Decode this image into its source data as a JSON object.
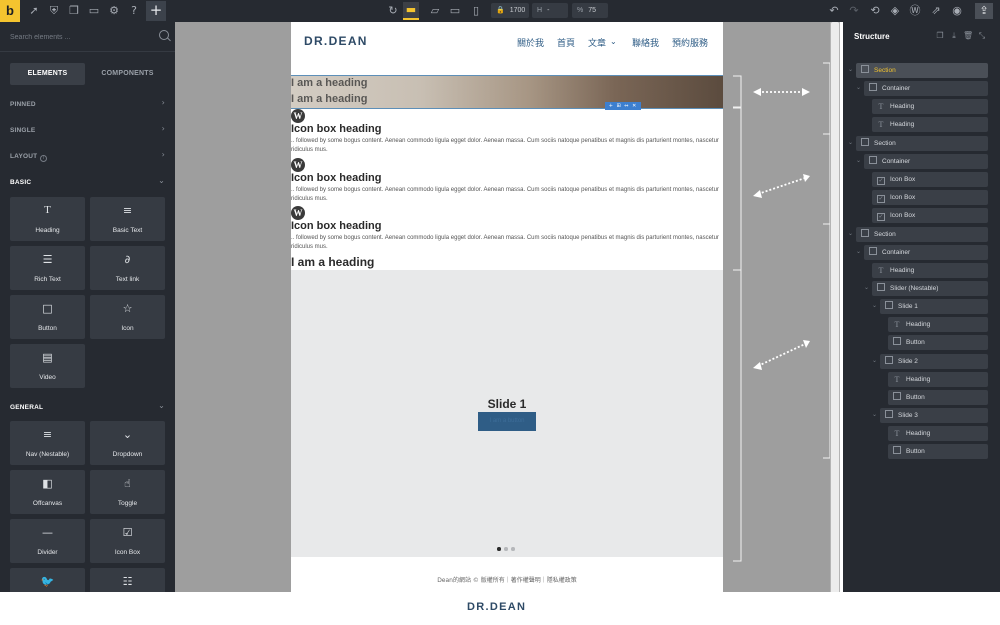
{
  "topbar": {
    "logo": "b",
    "breakpoint_width": "1700",
    "height_label": "H",
    "height_value": "-",
    "zoom_label": "%",
    "zoom_value": "75"
  },
  "left_panel": {
    "search_placeholder": "Search elements ...",
    "tabs": [
      "ELEMENTS",
      "COMPONENTS"
    ],
    "sections": {
      "pinned": "PINNED",
      "single": "SINGLE",
      "layout": "LAYOUT",
      "basic": "BASIC",
      "general": "GENERAL"
    },
    "basic_elements": [
      {
        "label": "Heading",
        "icon": "heading-icon"
      },
      {
        "label": "Basic Text",
        "icon": "basic-text-icon"
      },
      {
        "label": "Rich Text",
        "icon": "rich-text-icon"
      },
      {
        "label": "Text link",
        "icon": "link-icon"
      },
      {
        "label": "Button",
        "icon": "button-icon"
      },
      {
        "label": "Icon",
        "icon": "star-icon"
      },
      {
        "label": "Video",
        "icon": "video-icon"
      }
    ],
    "general_elements": [
      {
        "label": "Nav (Nestable)",
        "icon": "menu-icon"
      },
      {
        "label": "Dropdown",
        "icon": "dropdown-icon"
      },
      {
        "label": "Offcanvas",
        "icon": "offcanvas-icon"
      },
      {
        "label": "Toggle",
        "icon": "toggle-icon"
      },
      {
        "label": "Divider",
        "icon": "divider-icon"
      },
      {
        "label": "Icon Box",
        "icon": "icon-box-icon"
      },
      {
        "label": "",
        "icon": "twitter-icon"
      },
      {
        "label": "",
        "icon": "list-icon"
      }
    ]
  },
  "page": {
    "logo": "DR.DEAN",
    "nav": [
      "關於我",
      "首頁",
      "文章",
      "聯絡我",
      "預約服務"
    ],
    "hero_headings": [
      "I am a heading",
      "I am a heading"
    ],
    "icon_boxes": [
      {
        "heading": "Icon box heading",
        "text": ".. followed by some bogus content. Aenean commodo ligula egget dolor. Aenean massa. Cum sociis natoque penatibus et magnis dis parturient montes, nascetur ridiculus mus."
      },
      {
        "heading": "Icon box heading",
        "text": ".. followed by some bogus content. Aenean commodo ligula egget dolor. Aenean massa. Cum sociis natoque penatibus et magnis dis parturient montes, nascetur ridiculus mus."
      },
      {
        "heading": "Icon box heading",
        "text": ".. followed by some bogus content. Aenean commodo ligula egget dolor. Aenean massa. Cum sociis natoque penatibus et magnis dis parturient montes, nascetur ridiculus mus."
      }
    ],
    "plain_heading": "I am a heading",
    "slide": {
      "title": "Slide 1",
      "button": "I am a button"
    },
    "footer": "Dean的網站 © 版權所有｜著作權聲明｜隱私權政策"
  },
  "structure": {
    "title": "Structure",
    "tree": [
      {
        "label": "Section",
        "icon": "section-icon",
        "depth": 0,
        "selected": true
      },
      {
        "label": "Container",
        "icon": "container-icon",
        "depth": 1
      },
      {
        "label": "Heading",
        "icon": "heading-icon",
        "depth": 2
      },
      {
        "label": "Heading",
        "icon": "heading-icon",
        "depth": 2
      },
      {
        "label": "Section",
        "icon": "section-icon",
        "depth": 0
      },
      {
        "label": "Container",
        "icon": "container-icon",
        "depth": 1
      },
      {
        "label": "Icon Box",
        "icon": "icon-box-icon",
        "depth": 2
      },
      {
        "label": "Icon Box",
        "icon": "icon-box-icon",
        "depth": 2
      },
      {
        "label": "Icon Box",
        "icon": "icon-box-icon",
        "depth": 2
      },
      {
        "label": "Section",
        "icon": "section-icon",
        "depth": 0
      },
      {
        "label": "Container",
        "icon": "container-icon",
        "depth": 1
      },
      {
        "label": "Heading",
        "icon": "heading-icon",
        "depth": 2
      },
      {
        "label": "Slider (Nestable)",
        "icon": "slider-icon",
        "depth": 2
      },
      {
        "label": "Slide 1",
        "icon": "container-icon",
        "depth": 3
      },
      {
        "label": "Heading",
        "icon": "heading-icon",
        "depth": 4
      },
      {
        "label": "Button",
        "icon": "button-icon",
        "depth": 4
      },
      {
        "label": "Slide 2",
        "icon": "container-icon",
        "depth": 3
      },
      {
        "label": "Heading",
        "icon": "heading-icon",
        "depth": 4
      },
      {
        "label": "Button",
        "icon": "button-icon",
        "depth": 4
      },
      {
        "label": "Slide 3",
        "icon": "container-icon",
        "depth": 3
      },
      {
        "label": "Heading",
        "icon": "heading-icon",
        "depth": 4
      },
      {
        "label": "Button",
        "icon": "button-icon",
        "depth": 4
      }
    ]
  },
  "bottom_logo": "DR.DEAN",
  "colors": {
    "panel_bg": "#262a31",
    "accent": "#f4c42f",
    "brand": "#2e4a66",
    "nav_link": "#2f5d86",
    "selection_outline": "#5d8fb8"
  }
}
